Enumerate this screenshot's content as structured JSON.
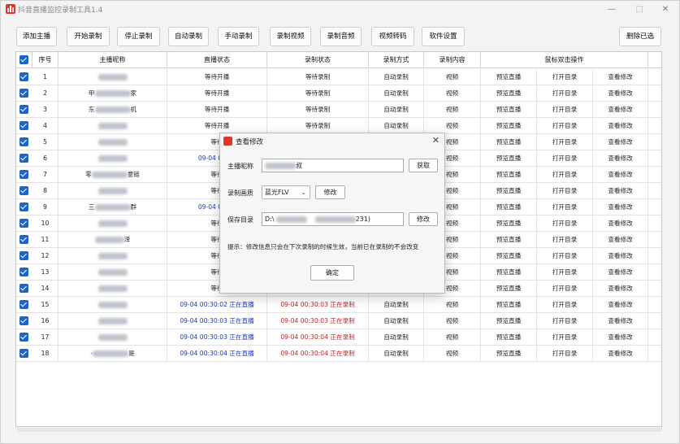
{
  "window": {
    "title": "抖音直播监控录制工具1.4",
    "minimize": "—",
    "maximize": "□",
    "close": "✕"
  },
  "toolbar": [
    "添加主播",
    "开始录制",
    "停止录制",
    "自动录制",
    "手动录制",
    "录制视频",
    "录制音频",
    "视频转码",
    "软件设置",
    "删除已选"
  ],
  "columns": [
    "序号",
    "主播昵称",
    "直播状态",
    "录制状态",
    "录制方式",
    "录制内容",
    "鼠标双击操作"
  ],
  "rows": [
    {
      "no": "1",
      "name": "",
      "live": "等待开播",
      "rec": "等待录制",
      "mode": "自动录制",
      "content": "视频",
      "state": "wait"
    },
    {
      "no": "2",
      "name": "甲 家",
      "live": "等待开播",
      "rec": "等待录制",
      "mode": "自动录制",
      "content": "视频",
      "state": "wait"
    },
    {
      "no": "3",
      "name": "东 机",
      "live": "等待开播",
      "rec": "等待录制",
      "mode": "自动录制",
      "content": "视频",
      "state": "wait"
    },
    {
      "no": "4",
      "name": "",
      "live": "等待开播",
      "rec": "等待录制",
      "mode": "自动录制",
      "content": "视频",
      "state": "wait"
    },
    {
      "no": "5",
      "name": "",
      "live": "等待",
      "rec": "",
      "mode": "",
      "content": "视频",
      "state": "wait"
    },
    {
      "no": "6",
      "name": "",
      "live": "09-04 00:29",
      "rec": "",
      "mode": "",
      "content": "视频",
      "state": "partial"
    },
    {
      "no": "7",
      "name": "零 意链",
      "live": "等待",
      "rec": "",
      "mode": "",
      "content": "视频",
      "state": "wait"
    },
    {
      "no": "8",
      "name": "",
      "live": "等待",
      "rec": "",
      "mode": "",
      "content": "视频",
      "state": "wait"
    },
    {
      "no": "9",
      "name": "三 群",
      "live": "09-04 00:29",
      "rec": "",
      "mode": "",
      "content": "视频",
      "state": "partial"
    },
    {
      "no": "10",
      "name": "",
      "live": "等待",
      "rec": "",
      "mode": "",
      "content": "视频",
      "state": "wait"
    },
    {
      "no": "11",
      "name": "泽",
      "live": "等待",
      "rec": "",
      "mode": "",
      "content": "视频",
      "state": "wait"
    },
    {
      "no": "12",
      "name": "",
      "live": "等待",
      "rec": "",
      "mode": "",
      "content": "视频",
      "state": "wait"
    },
    {
      "no": "13",
      "name": "",
      "live": "等待",
      "rec": "",
      "mode": "",
      "content": "视频",
      "state": "wait"
    },
    {
      "no": "14",
      "name": "",
      "live": "等待",
      "rec": "",
      "mode": "",
      "content": "视频",
      "state": "wait"
    },
    {
      "no": "15",
      "name": "",
      "live": "09-04 00:30:02 正在直播",
      "rec": "09-04 00:30:03 正在录制",
      "mode": "自动录制",
      "content": "视频",
      "state": "live"
    },
    {
      "no": "16",
      "name": "",
      "live": "09-04 00:30:03 正在直播",
      "rec": "09-04 00:30:03 正在录制",
      "mode": "自动录制",
      "content": "视频",
      "state": "live"
    },
    {
      "no": "17",
      "name": "",
      "live": "09-04 00:30:03 正在直播",
      "rec": "09-04 00:30:04 正在录制",
      "mode": "自动录制",
      "content": "视频",
      "state": "live"
    },
    {
      "no": "18",
      "name": "- 是",
      "live": "09-04 00:30:04 正在直播",
      "rec": "09-04 00:30:04 正在录制",
      "mode": "自动录制",
      "content": "视频",
      "state": "live"
    }
  ],
  "row_actions": [
    "预览直播",
    "打开目录",
    "查看修改"
  ],
  "dialog": {
    "title": "查看修改",
    "close": "✕",
    "name_label": "主播昵称",
    "name_value": "叔",
    "fetch_btn": "获取",
    "quality_label": "录制画质",
    "quality_value": "蓝光FLV",
    "edit_btn": "修改",
    "dir_label": "保存目录",
    "dir_value": "D:\\",
    "dir_value_tail": "231)",
    "dir_btn": "修改",
    "hint": "提示：修改信息只会在下次录制的时候生效，当前已在录制的不会改变",
    "ok_btn": "确定"
  },
  "colors": {
    "accent": "#1f64c8",
    "live": "#1837c9",
    "recording": "#d31a1a",
    "brand": "#e0352b"
  }
}
